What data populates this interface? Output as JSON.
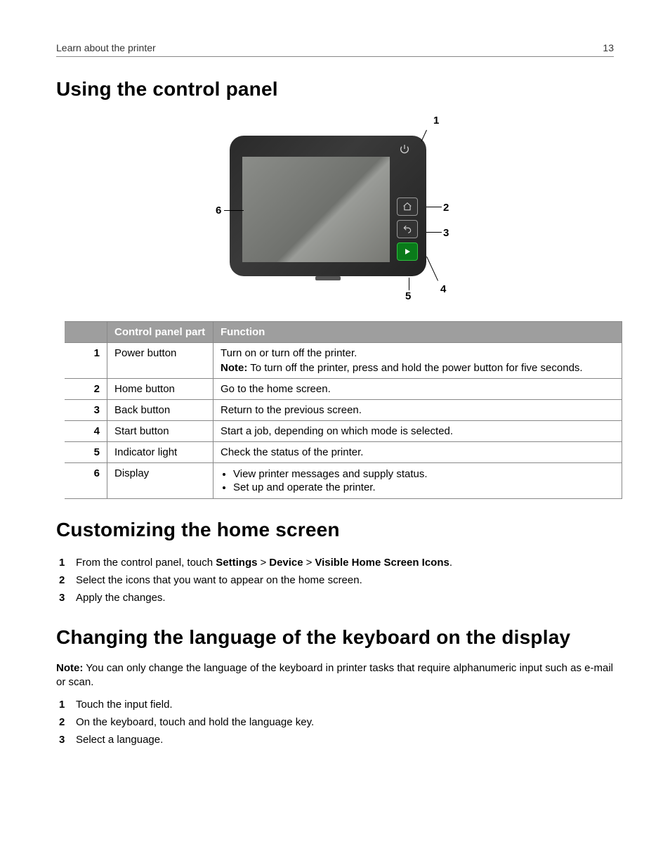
{
  "header": {
    "section": "Learn about the printer",
    "page_number": "13"
  },
  "section1": {
    "title": "Using the control panel",
    "callouts": [
      "1",
      "2",
      "3",
      "4",
      "5",
      "6"
    ],
    "table": {
      "headers": {
        "num": "",
        "part": "Control panel part",
        "func": "Function"
      },
      "rows": [
        {
          "num": "1",
          "part": "Power button",
          "main": "Turn on or turn off the printer.",
          "note_label": "Note:",
          "note_body": "To turn off the printer, press and hold the power button for five seconds."
        },
        {
          "num": "2",
          "part": "Home button",
          "main": "Go to the home screen."
        },
        {
          "num": "3",
          "part": "Back button",
          "main": "Return to the previous screen."
        },
        {
          "num": "4",
          "part": "Start button",
          "main": "Start a job, depending on which mode is selected."
        },
        {
          "num": "5",
          "part": "Indicator light",
          "main": "Check the status of the printer."
        },
        {
          "num": "6",
          "part": "Display",
          "bullets": [
            "View printer messages and supply status.",
            "Set up and operate the printer."
          ]
        }
      ]
    }
  },
  "section2": {
    "title": "Customizing the home screen",
    "steps": {
      "s1_prefix": "From the control panel, touch ",
      "s1_b1": "Settings",
      "s1_sep": ">",
      "s1_b2": "Device",
      "s1_b3": "Visible Home Screen Icons",
      "s1_suffix": ".",
      "s2": "Select the icons that you want to appear on the home screen.",
      "s3": "Apply the changes."
    }
  },
  "section3": {
    "title": "Changing the language of the keyboard on the display",
    "note_label": "Note:",
    "note_body": "You can only change the language of the keyboard in printer tasks that require alphanumeric input such as e-mail or scan.",
    "steps": {
      "s1": "Touch the input field.",
      "s2": "On the keyboard, touch and hold the language key.",
      "s3": "Select a language."
    }
  }
}
